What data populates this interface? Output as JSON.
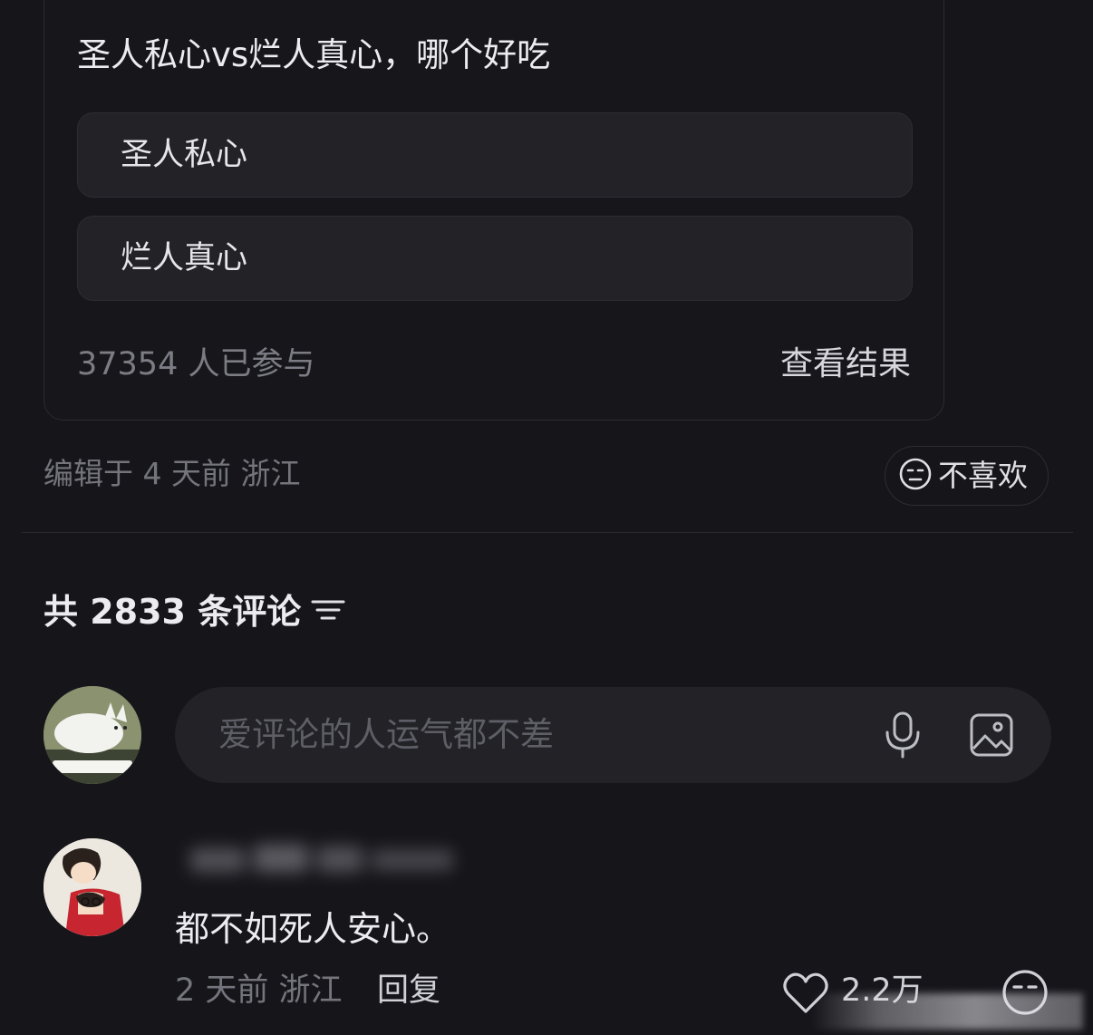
{
  "poll": {
    "title": "圣人私心vs烂人真心，哪个好吃",
    "options": [
      {
        "label": "圣人私心"
      },
      {
        "label": "烂人真心"
      }
    ],
    "participants": "37354 人已参与",
    "view_results": "查看结果"
  },
  "post_meta": {
    "edited": "编辑于 4 天前  浙江",
    "dislike_label": "不喜欢"
  },
  "comments": {
    "count_label": "共 2833 条评论",
    "input_placeholder": "爱评论的人运气都不差",
    "items": [
      {
        "text": "都不如死人安心。",
        "meta": "2 天前  浙江",
        "reply_label": "回复",
        "likes": "2.2万"
      }
    ]
  },
  "colors": {
    "background": "#16161a",
    "option_bg": "#222227",
    "muted_text": "#74747c"
  },
  "icons": [
    "sad-face-icon",
    "filter-icon",
    "mic-icon",
    "image-icon",
    "heart-icon"
  ]
}
